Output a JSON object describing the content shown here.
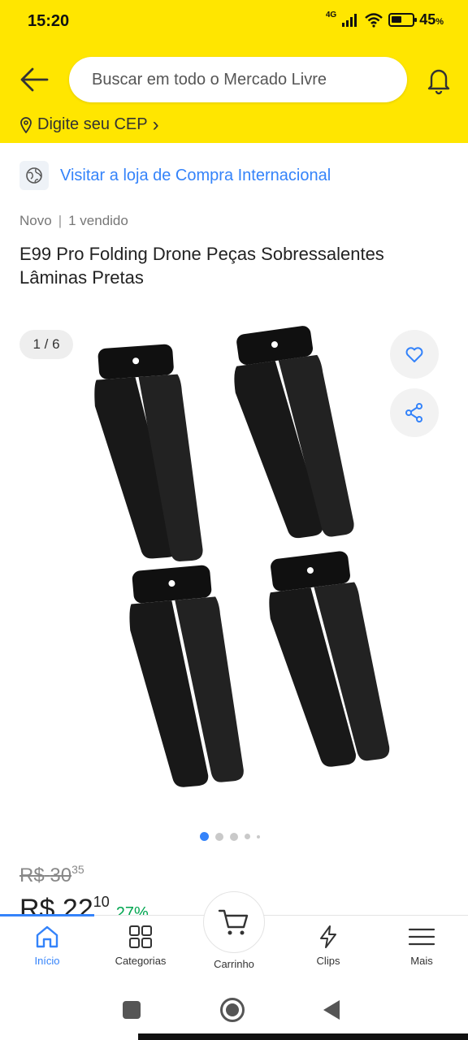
{
  "status_bar": {
    "time": "15:20",
    "network": "4G",
    "battery": "45",
    "battery_unit": "%"
  },
  "header": {
    "search_placeholder": "Buscar em todo o Mercado Livre",
    "cep_label": "Digite seu CEP",
    "cep_chevron": "›"
  },
  "store": {
    "link_text": "Visitar a loja de Compra Internacional"
  },
  "product": {
    "condition": "Novo",
    "separator": "|",
    "sold": "1 vendido",
    "title": "E99 Pro Folding Drone Peças Sobressalentes Lâminas Pretas"
  },
  "gallery": {
    "counter": "1 / 6",
    "current_index": 1,
    "total_images": 6
  },
  "price": {
    "old_currency": "R$",
    "old_whole": "30",
    "old_cents": "35",
    "new_currency": "R$",
    "new_whole": "22",
    "new_cents": "10",
    "discount": "27%"
  },
  "bottom_nav": {
    "items": [
      {
        "label": "Início",
        "icon": "home-icon"
      },
      {
        "label": "Categorias",
        "icon": "grid-icon"
      },
      {
        "label": "Carrinho",
        "icon": "cart-icon"
      },
      {
        "label": "Clips",
        "icon": "bolt-icon"
      },
      {
        "label": "Mais",
        "icon": "menu-icon"
      }
    ],
    "active_index": 0
  },
  "colors": {
    "brand_yellow": "#ffe600",
    "accent_blue": "#3483fa",
    "discount_green": "#00a650"
  }
}
